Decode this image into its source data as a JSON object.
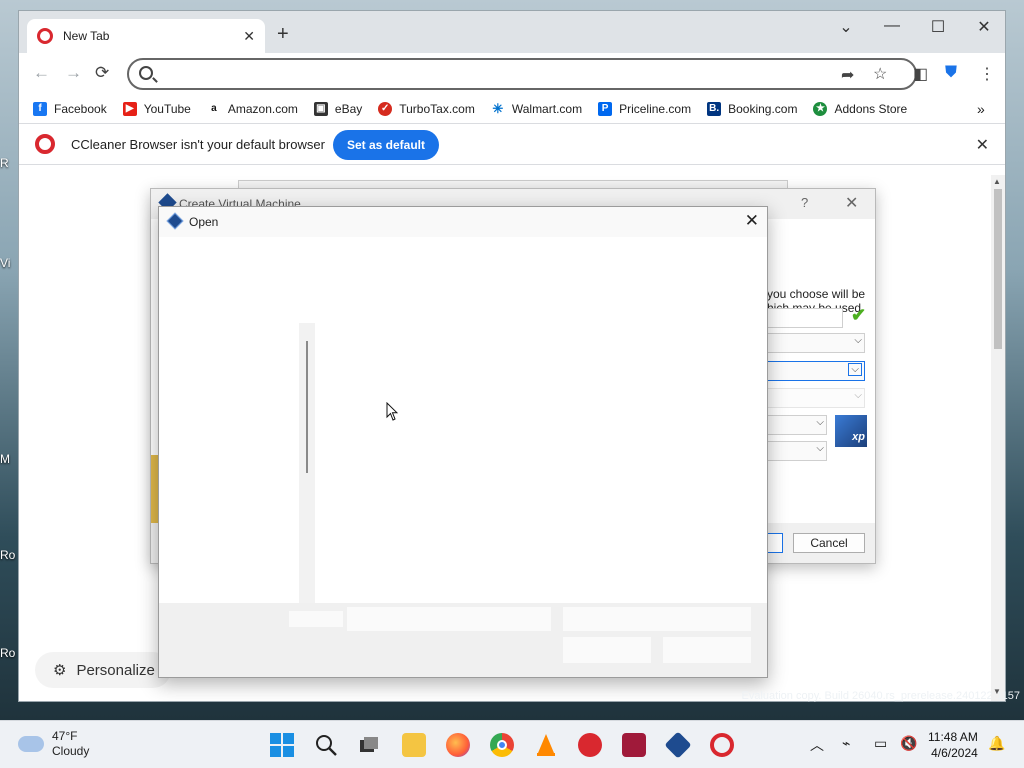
{
  "browser": {
    "tab_title": "New Tab",
    "omnibox_placeholder": "",
    "bookmarks": [
      "Facebook",
      "YouTube",
      "Amazon.com",
      "eBay",
      "TurboTax.com",
      "Walmart.com",
      "Priceline.com",
      "Booking.com",
      "Addons Store"
    ],
    "infobar_message": "CCleaner Browser isn't your default browser",
    "infobar_button": "Set as default",
    "personalize_label": "Personalize"
  },
  "create_vm_dialog": {
    "title": "Create Virtual Machine",
    "help": "?",
    "desc_line1": "you choose will be",
    "desc_line2": "hich may be used",
    "os_badge": "xp",
    "cancel_label": "Cancel"
  },
  "open_dialog": {
    "title": "Open"
  },
  "desktop": {
    "watermark": "Evaluation copy. Build 26040.rs_prerelease.240122-1157"
  },
  "taskbar": {
    "weather_temp": "47°F",
    "weather_desc": "Cloudy",
    "time": "11:48 AM",
    "date": "4/6/2024"
  },
  "colors": {
    "accent": "#1a73e8",
    "ccleaner_red": "#d9282f"
  }
}
